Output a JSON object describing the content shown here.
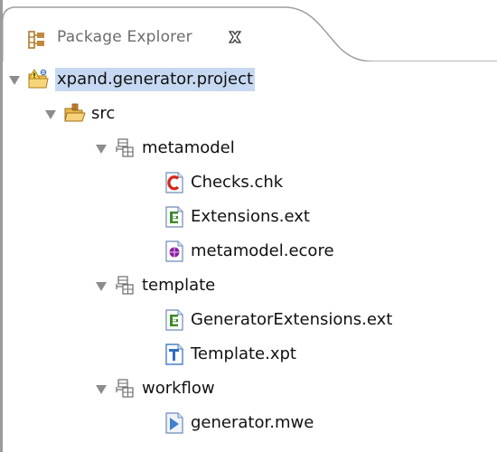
{
  "view": {
    "title": "Package Explorer",
    "icon": "package-explorer-icon",
    "close_icon": "close-icon"
  },
  "tree": [
    {
      "key": "project",
      "label": "xpand.generator.project",
      "icon": "project-icon",
      "depth": 0,
      "expanded": true,
      "selected": true
    },
    {
      "key": "src",
      "label": "src",
      "icon": "source-folder-icon",
      "depth": 1,
      "expanded": true
    },
    {
      "key": "pkg-metamodel",
      "label": "metamodel",
      "icon": "package-icon",
      "depth": 2,
      "expanded": true
    },
    {
      "key": "checks",
      "label": "Checks.chk",
      "icon": "check-file-icon",
      "depth": 3
    },
    {
      "key": "extensions",
      "label": "Extensions.ext",
      "icon": "extension-file-icon",
      "depth": 3
    },
    {
      "key": "ecore",
      "label": "metamodel.ecore",
      "icon": "ecore-file-icon",
      "depth": 3
    },
    {
      "key": "pkg-template",
      "label": "template",
      "icon": "package-icon",
      "depth": 2,
      "expanded": true
    },
    {
      "key": "genext",
      "label": "GeneratorExtensions.ext",
      "icon": "extension-file-icon",
      "depth": 3
    },
    {
      "key": "template-xpt",
      "label": "Template.xpt",
      "icon": "template-file-icon",
      "depth": 3
    },
    {
      "key": "pkg-workflow",
      "label": "workflow",
      "icon": "package-icon",
      "depth": 2,
      "expanded": true
    },
    {
      "key": "mwe",
      "label": "generator.mwe",
      "icon": "workflow-file-icon",
      "depth": 3
    }
  ]
}
